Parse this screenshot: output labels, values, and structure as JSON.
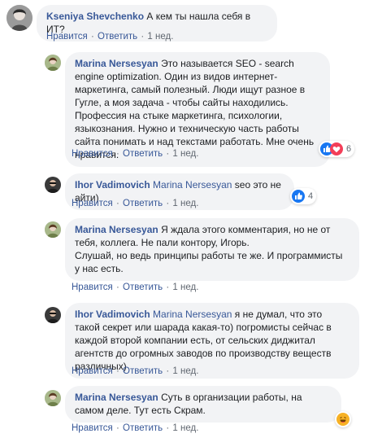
{
  "actions": {
    "like": "Нравится",
    "reply": "Ответить",
    "sep": "·"
  },
  "colors": {
    "link": "#385898",
    "bubble": "#f2f3f5",
    "like_blue": "#1877f2",
    "love_red": "#f33e58",
    "haha_yellow": "#f7b125"
  },
  "comments": [
    {
      "author": "Kseniya Shevchenko",
      "text": "А кем ты нашла себя в ИТ?",
      "time": "1 нед."
    },
    {
      "author": "Marina Nersesyan",
      "text": "Это называется SEO - search engine optimization. Один из видов интернет-маркетинга, самый полезный. Люди ищут разное в Гугле, а моя задача - чтобы сайты находились. Профессия на стыке маркетинга, психологии, языкознания. Нужно и техническую часть работы сайта понимать и над текстами работать. Мне очень нравится.",
      "time": "1 нед.",
      "reactions": {
        "icons": [
          "like-icon",
          "love-icon"
        ],
        "count": "6"
      }
    },
    {
      "author": "Ihor Vadimovich",
      "mention": "Marina Nersesyan",
      "text": "seo это не айти)",
      "time": "1 нед.",
      "reactions": {
        "icons": [
          "like-icon"
        ],
        "count": "4"
      }
    },
    {
      "author": "Marina Nersesyan",
      "text": "Я ждала этого комментария, но не от тебя, коллега. Не пали контору, Игорь.",
      "text2": "Слушай, но ведь принципы работы те же. И программисты у нас есть.",
      "time": "1 нед."
    },
    {
      "author": "Ihor Vadimovich",
      "mention": "Marina Nersesyan",
      "text": "я не думал, что это такой секрет или шарада какая-то) погромисты сейчас в каждой второй компании есть, от сельских диджитал агентств до огромных заводов по производству веществ различных)",
      "time": "1 нед."
    },
    {
      "author": "Marina Nersesyan",
      "text": "Суть в организации работы, на самом деле. Тут есть Скрам.",
      "time": "1 нед.",
      "reactions": {
        "icons": [
          "haha-icon"
        ],
        "count": ""
      }
    }
  ]
}
